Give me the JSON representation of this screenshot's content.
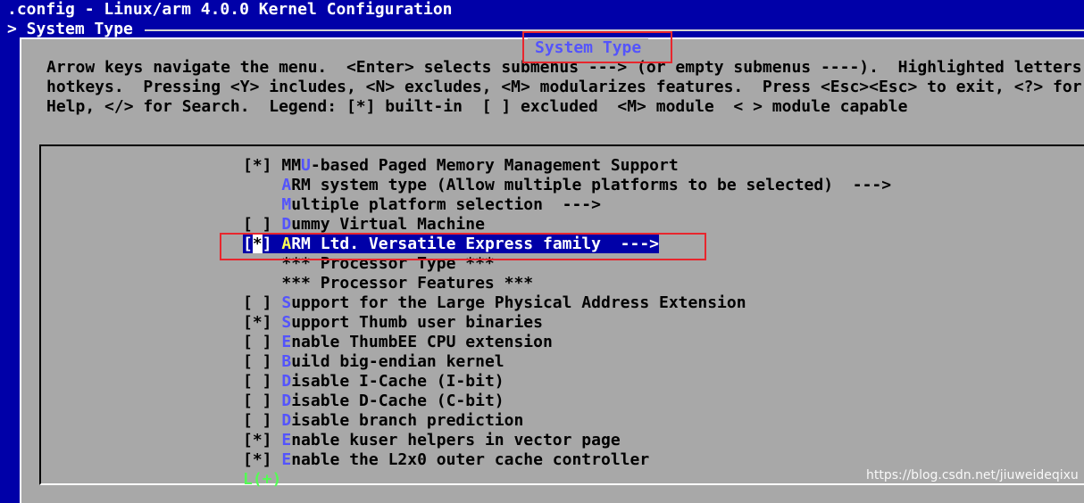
{
  "window": {
    "title": ".config - Linux/arm 4.0.0 Kernel Configuration",
    "breadcrumb": "> System Type"
  },
  "dialog": {
    "title": "System Type",
    "help_lines": [
      "Arrow keys navigate the menu.  <Enter> selects submenus ---> (or empty submenus ----).  Highlighted letters are",
      "hotkeys.  Pressing <Y> includes, <N> excludes, <M> modularizes features.  Press <Esc><Esc> to exit, <?> for",
      "Help, </> for Search.  Legend: [*] built-in  [ ] excluded  <M> module  < > module capable"
    ]
  },
  "menu": {
    "items": [
      {
        "prefix": "[*] ",
        "pre": "MM",
        "hotkey": "U",
        "rest": "-based Paged Memory Management Support"
      },
      {
        "prefix": "    ",
        "pre": "",
        "hotkey": "A",
        "rest": "RM system type (Allow multiple platforms to be selected)  --->"
      },
      {
        "prefix": "    ",
        "pre": "",
        "hotkey": "M",
        "rest": "ultiple platform selection  --->"
      },
      {
        "prefix": "[ ] ",
        "pre": "",
        "hotkey": "D",
        "rest": "ummy Virtual Machine"
      },
      {
        "prefix": "[*] ",
        "pre": "",
        "hotkey": "A",
        "rest": "RM Ltd. Versatile Express family  --->",
        "selected": true
      },
      {
        "prefix": "    ",
        "pre": "",
        "hotkey": "",
        "rest": "*** Processor Type ***"
      },
      {
        "prefix": "    ",
        "pre": "",
        "hotkey": "",
        "rest": "*** Processor Features ***"
      },
      {
        "prefix": "[ ] ",
        "pre": "",
        "hotkey": "S",
        "rest": "upport for the Large Physical Address Extension"
      },
      {
        "prefix": "[*] ",
        "pre": "",
        "hotkey": "S",
        "rest": "upport Thumb user binaries"
      },
      {
        "prefix": "[ ] ",
        "pre": "",
        "hotkey": "E",
        "rest": "nable ThumbEE CPU extension"
      },
      {
        "prefix": "[ ] ",
        "pre": "",
        "hotkey": "B",
        "rest": "uild big-endian kernel"
      },
      {
        "prefix": "[ ] ",
        "pre": "",
        "hotkey": "D",
        "rest": "isable I-Cache (I-bit)"
      },
      {
        "prefix": "[ ] ",
        "pre": "",
        "hotkey": "D",
        "rest": "isable D-Cache (C-bit)"
      },
      {
        "prefix": "[ ] ",
        "pre": "",
        "hotkey": "D",
        "rest": "isable branch prediction"
      },
      {
        "prefix": "[*] ",
        "pre": "",
        "hotkey": "E",
        "rest": "nable kuser helpers in vector page"
      },
      {
        "prefix": "[*] ",
        "pre": "",
        "hotkey": "E",
        "rest": "nable the L2x0 outer cache controller"
      }
    ],
    "more_indicator": "L(+)"
  },
  "watermark": "https://blog.csdn.net/jiuweideqixu",
  "colors": {
    "background": "#0000a8",
    "dialog": "#a8a8a8",
    "hotkey": "#5454fc",
    "selected_bg": "#0000a8",
    "selected_hotkey": "#ffff54",
    "annotation": "#e8262d",
    "more_indicator": "#54fc54"
  }
}
